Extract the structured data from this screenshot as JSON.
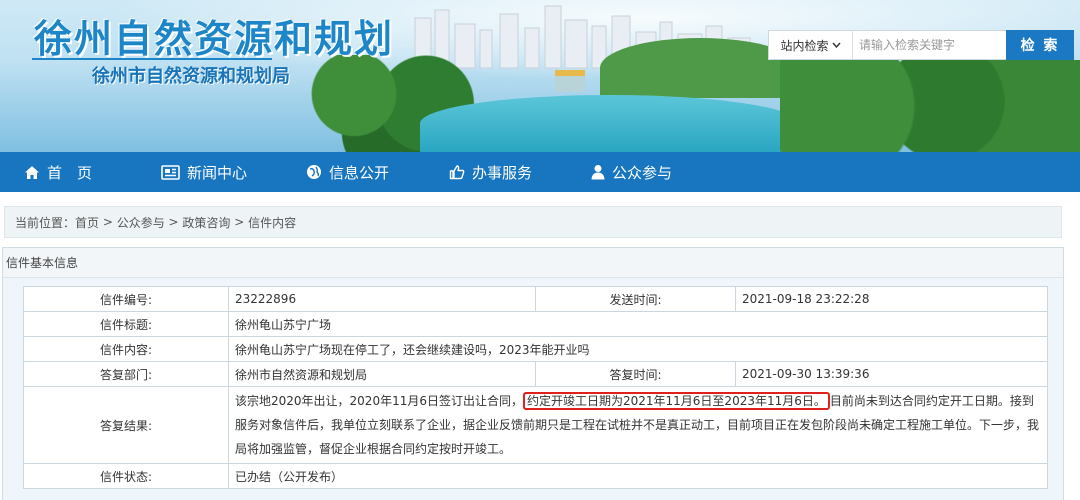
{
  "header": {
    "site_title": "徐州自然资源和规划",
    "site_subtitle": "徐州市自然资源和规划局"
  },
  "search": {
    "scope_label": "站内检索",
    "placeholder": "请输入检索关键字",
    "button_label": "检 索"
  },
  "nav": {
    "items": [
      {
        "label": "首　页",
        "icon": "home-icon"
      },
      {
        "label": "新闻中心",
        "icon": "newspaper-icon"
      },
      {
        "label": "信息公开",
        "icon": "globe-icon"
      },
      {
        "label": "办事服务",
        "icon": "thumbs-up-icon"
      },
      {
        "label": "公众参与",
        "icon": "user-icon"
      }
    ]
  },
  "breadcrumb": {
    "prefix": "当前位置：",
    "items": [
      "首页",
      "公众参与",
      "政策咨询",
      "信件内容"
    ],
    "separator": " > "
  },
  "panel": {
    "title": "信件基本信息",
    "rows": {
      "letter_no_label": "信件编号:",
      "letter_no": "23222896",
      "send_time_label": "发送时间:",
      "send_time": "2021-09-18 23:22:28",
      "letter_title_label": "信件标题:",
      "letter_title": "徐州龟山苏宁广场",
      "letter_content_label": "信件内容:",
      "letter_content": "徐州龟山苏宁广场现在停工了，还会继续建设吗，2023年能开业吗",
      "reply_dept_label": "答复部门:",
      "reply_dept": "徐州市自然资源和规划局",
      "reply_time_label": "答复时间:",
      "reply_time": "2021-09-30 13:39:36",
      "reply_result_label": "答复结果:",
      "reply_part1": "该宗地2020年出让，2020年11月6日签订出让合同，",
      "reply_highlight": "约定开竣工日期为2021年11月6日至2023年11月6日。",
      "reply_part2": "目前尚未到达合同约定开工日期。接到服务对象信件后，我单位立刻联系了企业，据企业反馈前期只是工程在试桩并不是真正动工，目前项目正在发包阶段尚未确定工程施工单位。下一步，我局将加强监管，督促企业根据合同约定按时开竣工。",
      "status_label": "信件状态:",
      "status": "已办结（公开发布）"
    }
  },
  "colors": {
    "nav_bg": "#1776bf",
    "title_blue": "#1d86c8",
    "highlight_border": "#e0201c"
  }
}
